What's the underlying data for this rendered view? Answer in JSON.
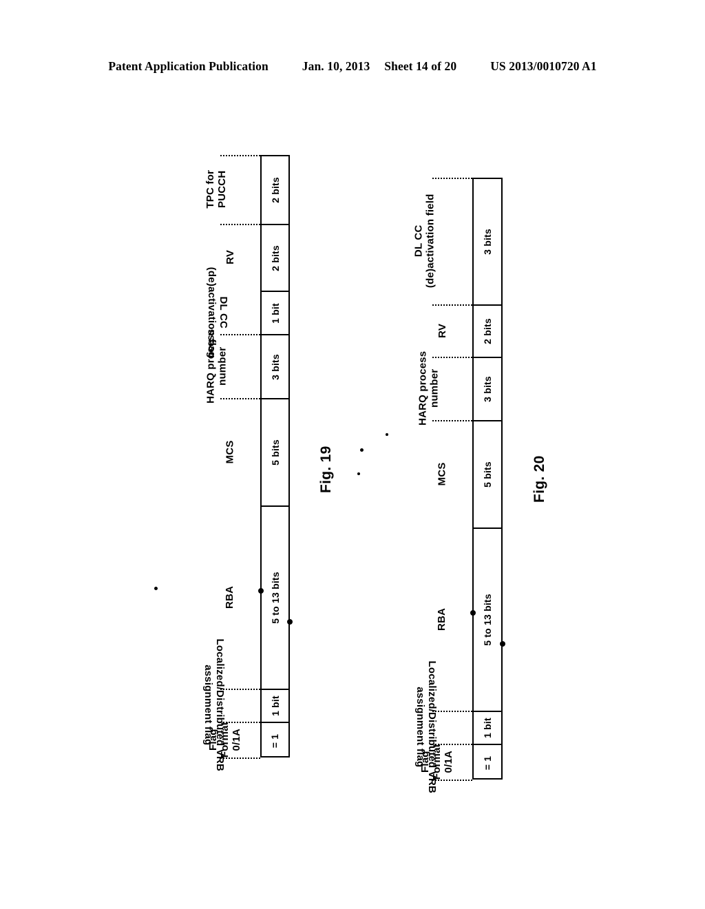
{
  "header": {
    "publication": "Patent Application Publication",
    "date": "Jan. 10, 2013",
    "sheet": "Sheet 14 of 20",
    "number": "US 2013/0010720 A1"
  },
  "figures": [
    {
      "caption": "Fig. 19",
      "fields": [
        {
          "label": "TPC for\nPUCCH",
          "size": "2 bits",
          "flipped": false
        },
        {
          "label": "RV",
          "size": "2 bits",
          "flipped": false
        },
        {
          "label": "DL CC\n(de)activation flag",
          "size": "1 bit",
          "flipped": true
        },
        {
          "label": "HARQ process\nnumber",
          "size": "3 bits",
          "flipped": false
        },
        {
          "label": "MCS",
          "size": "5 bits",
          "flipped": false
        },
        {
          "label": "RBA",
          "size": "5 to 13 bits",
          "flipped": false
        },
        {
          "label": "Localized/Distributed VRB\nassignment flag",
          "size": "1 bit",
          "flipped": true
        },
        {
          "label": "Flag\nFormat\n0/1A",
          "size": "= 1",
          "flipped": false
        }
      ]
    },
    {
      "caption": "Fig. 20",
      "fields": [
        {
          "label": "DL CC\n(de)activation field",
          "size": "3 bits",
          "flipped": false
        },
        {
          "label": "RV",
          "size": "2 bits",
          "flipped": false
        },
        {
          "label": "HARQ process\nnumber",
          "size": "3 bits",
          "flipped": false
        },
        {
          "label": "MCS",
          "size": "5 bits",
          "flipped": false
        },
        {
          "label": "RBA",
          "size": "5 to 13 bits",
          "flipped": false
        },
        {
          "label": "Localized/Distributed VRB\nassignment flag",
          "size": "1 bit",
          "flipped": true
        },
        {
          "label": "Flag\nFormat\n0/1A",
          "size": "= 1",
          "flipped": false
        }
      ]
    }
  ]
}
